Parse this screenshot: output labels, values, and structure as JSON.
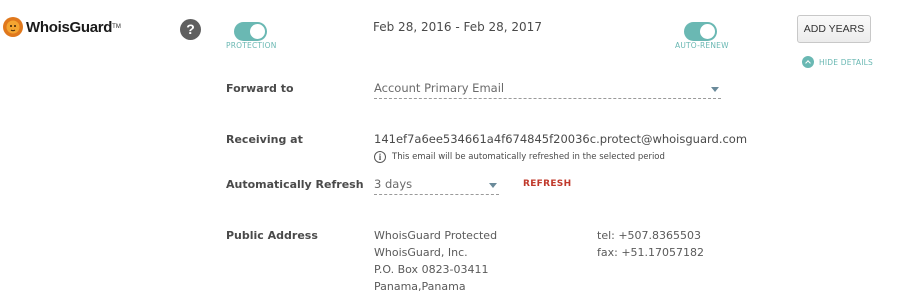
{
  "brand": {
    "name": "WhoisGuard",
    "tm": "TM"
  },
  "help": {
    "label": "?"
  },
  "protection": {
    "label": "PROTECTION",
    "enabled": true
  },
  "period": {
    "dates": "Feb 28, 2016 - Feb 28, 2017"
  },
  "auto_renew": {
    "label": "AUTO-RENEW",
    "enabled": true
  },
  "actions": {
    "add_years": "ADD YEARS",
    "hide_details": "HIDE DETAILS"
  },
  "forward": {
    "label": "Forward to",
    "value": "Account Primary Email"
  },
  "receiving": {
    "label": "Receiving at",
    "email": "141ef7a6ee534661a4f674845f20036c.protect@whoisguard.com",
    "note": "This email will be automatically refreshed in the selected period"
  },
  "auto_refresh": {
    "label": "Automatically Refresh",
    "value": "3 days",
    "action": "REFRESH"
  },
  "public_address": {
    "label": "Public Address",
    "lines": [
      "WhoisGuard Protected",
      "WhoisGuard, Inc.",
      "P.O. Box 0823-03411",
      "Panama,Panama"
    ],
    "tel": "tel: +507.8365503",
    "fax": "fax: +51.17057182"
  },
  "colors": {
    "accent": "#6ab8b3",
    "refresh": "#c0392b",
    "help_bg": "#5f5f5f"
  }
}
